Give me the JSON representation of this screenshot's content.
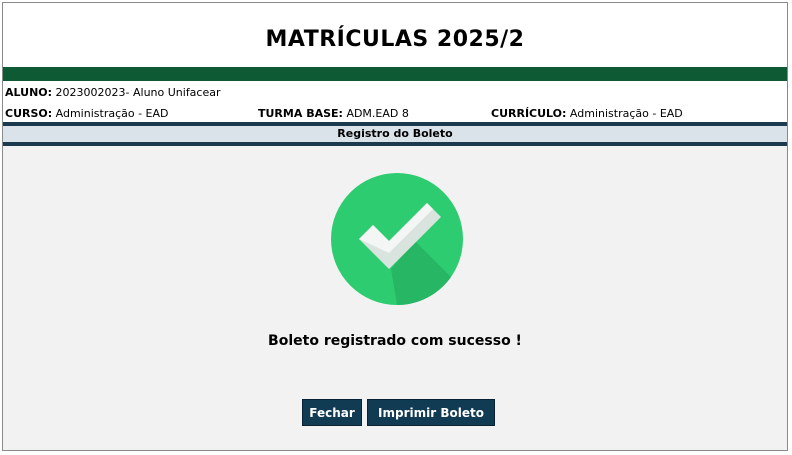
{
  "page_title": "MATRÍCULAS 2025/2",
  "student": {
    "aluno_label": "ALUNO:",
    "aluno_value": "2023002023- Aluno Unifacear",
    "curso_label": "CURSO:",
    "curso_value": "Administração - EAD",
    "turma_label": "TURMA BASE:",
    "turma_value": "ADM.EAD 8",
    "curriculo_label": "CURRÍCULO:",
    "curriculo_value": "Administração - EAD"
  },
  "section_title": "Registro do Boleto",
  "status": {
    "icon": "check-circle-icon",
    "message": "Boleto registrado com sucesso !"
  },
  "buttons": {
    "close_label": "Fechar",
    "print_label": "Imprimir Boleto"
  },
  "colors": {
    "header_green": "#0e5a34",
    "success_green": "#2ecc71",
    "button_navy": "#113a53"
  }
}
